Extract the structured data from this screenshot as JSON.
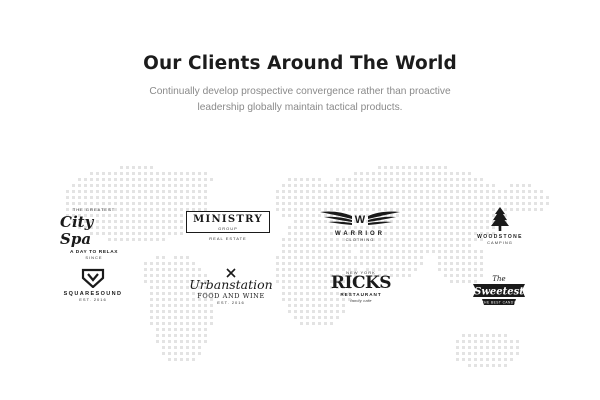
{
  "section": {
    "title": "Our Clients Around The World",
    "subtitle": "Continually develop prospective convergence rather than proactive leadership globally maintain tactical products."
  },
  "clients": {
    "city_spa": {
      "top": "THE GREATEST",
      "script": "City Spa",
      "tag": "A DAY TO RELAX",
      "bottom": "SINCE"
    },
    "ministry": {
      "name": "MINISTRY",
      "sub": "GROUP",
      "tag": "REAL ESTATE"
    },
    "warrior": {
      "mark": "W",
      "name": "WARRIOR",
      "tag": "CLOTHING"
    },
    "woodstone": {
      "name": "WOODSTONE",
      "tag": "CAMPING"
    },
    "squaresound": {
      "name": "SQUARESOUND",
      "tag": "EST. 2016"
    },
    "urbanstation": {
      "script": "Urbanstation",
      "line": "FOOD AND WINE",
      "tag": "EST. 2016"
    },
    "ricks": {
      "top": "NEW YORK",
      "name": "RICKS",
      "tag": "RESTAURANT",
      "sign": "family cafe"
    },
    "sweetest": {
      "top": "The",
      "name": "Sweetest",
      "tag": "THE BEST CANDY"
    }
  },
  "colors": {
    "title": "#1c1c1c",
    "subtitle": "#8a8a8a",
    "map_dots": "#e3e3e3",
    "logo": "#1a1a1a"
  }
}
